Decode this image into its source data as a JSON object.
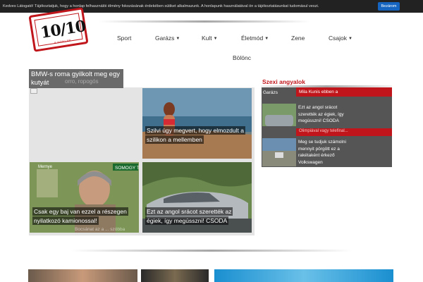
{
  "cookie_bar": {
    "text": "Kedves Látogató! Tájékoztatjuk, hogy a honlap felhasználói élmény fokozásának érdekében sütiket alkalmazunk. A honlapunk használatával ön a tájékoztatásunkat tudomásul veszi.",
    "button_label": "Bezárom"
  },
  "logo": {
    "text": "10/10",
    "subtext": "A HONLAP"
  },
  "nav": [
    {
      "label": "Sport",
      "has_dropdown": false
    },
    {
      "label": "Garázs",
      "has_dropdown": true
    },
    {
      "label": "Kult",
      "has_dropdown": true
    },
    {
      "label": "Életmód",
      "has_dropdown": true
    },
    {
      "label": "Zene",
      "has_dropdown": false
    },
    {
      "label": "Csajok",
      "has_dropdown": true
    },
    {
      "label": "Bölönc",
      "has_dropdown": false
    }
  ],
  "featured": {
    "title_line1": "BMW-s roma gyilkolt meg egy",
    "title_line2": "kutyát",
    "title_ghost": "orro, ropogós",
    "tiles": [
      {
        "caption": "Szilvi úgy megvert, hogy elmozdult a szilikon a mellemben"
      },
      {
        "caption": "Csak egy baj van ezzel a részegen nyilatkozó kamionossal!",
        "overlay": "Mernye",
        "ghost": "Bocsánat az a ... szóbba"
      },
      {
        "caption": "Ezt az angol srácot szerették az égiek, így megússzni! CSODA"
      }
    ]
  },
  "sidebar": {
    "title": "Szexi angyalok",
    "section_label": "Garázs",
    "items": [
      {
        "text": "Mila Kunis ebben a"
      },
      {
        "text": "Ezt az angol srácot szerették az égiek, így megússzni! CSODA"
      },
      {
        "text": "Olimpiával vagy telefinal..."
      },
      {
        "text": "Meg se tudjuk számolni mennyit pörgött ez a rakétaként érkező Volkswagen"
      }
    ]
  }
}
